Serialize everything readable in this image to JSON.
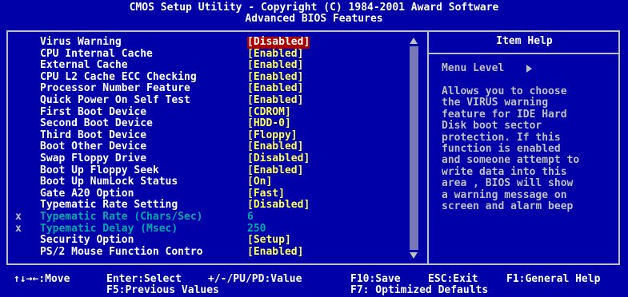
{
  "header": {
    "line1": "CMOS Setup Utility - Copyright (C) 1984-2001 Award Software",
    "line2": "Advanced BIOS Features"
  },
  "settings": [
    {
      "marker": "",
      "label": "Virus Warning",
      "value": "[Disabled]"
    },
    {
      "marker": "",
      "label": "CPU Internal Cache",
      "value": "[Enabled]"
    },
    {
      "marker": "",
      "label": "External Cache",
      "value": "[Enabled]"
    },
    {
      "marker": "",
      "label": "CPU L2 Cache ECC Checking",
      "value": "[Enabled]"
    },
    {
      "marker": "",
      "label": "Processor Number Feature",
      "value": "[Enabled]"
    },
    {
      "marker": "",
      "label": "Quick Power On Self Test",
      "value": "[Enabled]"
    },
    {
      "marker": "",
      "label": "First Boot Device",
      "value": "[CDROM]"
    },
    {
      "marker": "",
      "label": "Second Boot Device",
      "value": "[HDD-0]"
    },
    {
      "marker": "",
      "label": "Third Boot Device",
      "value": "[Floppy]"
    },
    {
      "marker": "",
      "label": "Boot Other Device",
      "value": "[Enabled]"
    },
    {
      "marker": "",
      "label": "Swap Floppy Drive",
      "value": "[Disabled]"
    },
    {
      "marker": "",
      "label": "Boot Up Floppy Seek",
      "value": "[Enabled]"
    },
    {
      "marker": "",
      "label": "Boot Up NumLock Status",
      "value": "[On]"
    },
    {
      "marker": "",
      "label": "Gate A20 Option",
      "value": "[Fast]"
    },
    {
      "marker": "",
      "label": "Typematic Rate Setting",
      "value": "[Disabled]"
    },
    {
      "marker": "x",
      "label": "Typematic Rate (Chars/Sec)",
      "value": "6"
    },
    {
      "marker": "x",
      "label": "Typematic Delay (Msec)",
      "value": "250"
    },
    {
      "marker": "",
      "label": "Security Option",
      "value": "[Setup]"
    },
    {
      "marker": "",
      "label": "PS/2 Mouse Function Contro",
      "value": "[Enabled]"
    }
  ],
  "help": {
    "title": "Item Help",
    "menu_level": "Menu Level",
    "lines": [
      "Allows you to choose",
      "the VIRUS warning",
      "feature for IDE Hard",
      "Disk boot sector",
      "protection. If this",
      "function is enabled",
      "and someone attempt to",
      "write data into this",
      "area ,  BIOS will show",
      "a warning message on",
      "screen and alarm beep"
    ]
  },
  "footer": {
    "move": "↑↓→←:Move",
    "enter": "Enter:Select",
    "pu_pd": "+/-/PU/PD:Value",
    "f10": "F10:Save",
    "esc": "ESC:Exit",
    "f1": "F1:General Help",
    "f5": "F5:Previous Values",
    "f7": "F7: Optimized Defaults"
  },
  "colors": {
    "background": "#0000a8",
    "label": "#ffffff",
    "value": "#ffff55",
    "disabled": "#00aaaa",
    "selection": "#aa0000",
    "frame": "#c0c0c0"
  }
}
